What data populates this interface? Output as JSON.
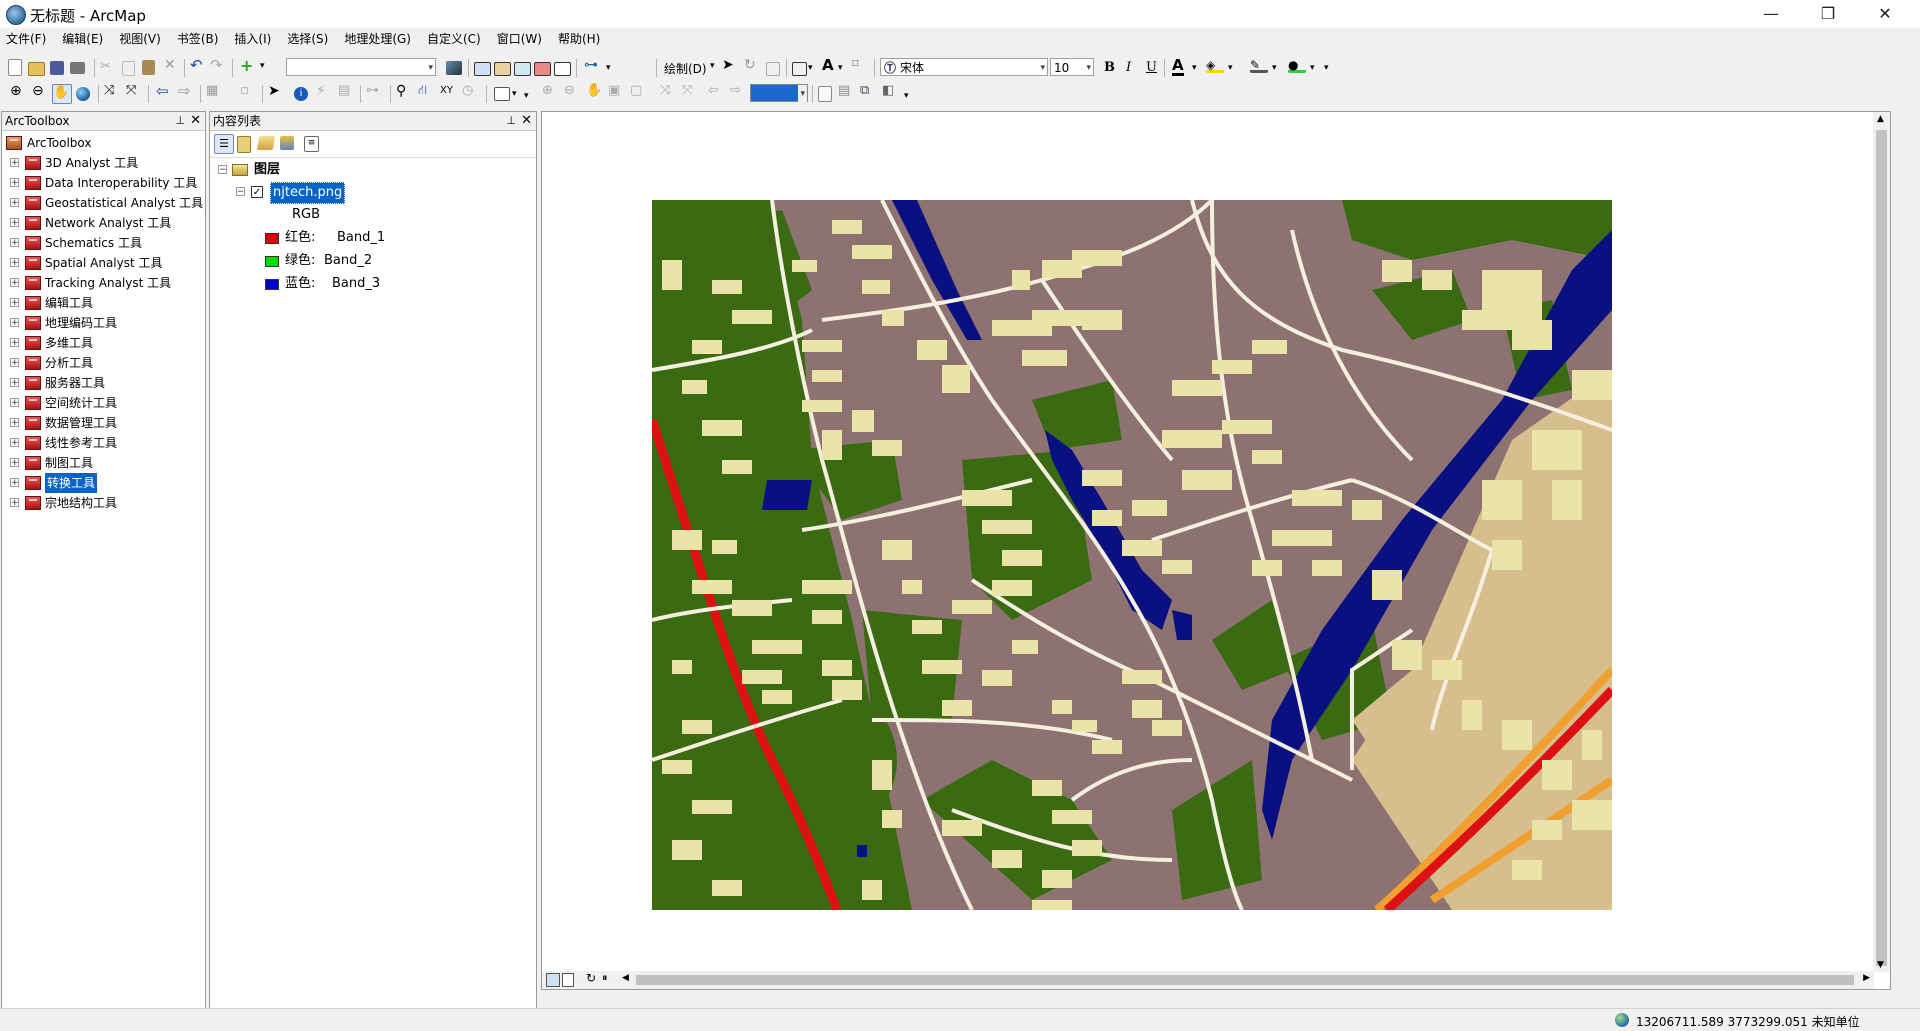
{
  "window": {
    "title": "无标题 - ArcMap",
    "minimize": "—",
    "restore": "❐",
    "close": "✕"
  },
  "menu": [
    "文件(F)",
    "编辑(E)",
    "视图(V)",
    "书签(B)",
    "插入(I)",
    "选择(S)",
    "地理处理(G)",
    "自定义(C)",
    "窗口(W)",
    "帮助(H)"
  ],
  "toolbar": {
    "draw_label": "绘制(D)",
    "font_name": "宋体",
    "font_size": "10",
    "bold": "B",
    "italic": "I",
    "underline": "U",
    "font_color_glyph": "A"
  },
  "arctoolbox": {
    "title": "ArcToolbox",
    "pin": "⊥",
    "close": "✕",
    "root": "ArcToolbox",
    "items": [
      {
        "label": "3D Analyst 工具"
      },
      {
        "label": "Data Interoperability 工具"
      },
      {
        "label": "Geostatistical Analyst 工具"
      },
      {
        "label": "Network Analyst 工具"
      },
      {
        "label": "Schematics 工具"
      },
      {
        "label": "Spatial Analyst 工具"
      },
      {
        "label": "Tracking Analyst 工具"
      },
      {
        "label": "编辑工具"
      },
      {
        "label": "地理编码工具"
      },
      {
        "label": "多维工具"
      },
      {
        "label": "分析工具"
      },
      {
        "label": "服务器工具"
      },
      {
        "label": "空间统计工具"
      },
      {
        "label": "数据管理工具"
      },
      {
        "label": "线性参考工具"
      },
      {
        "label": "制图工具"
      },
      {
        "label": "转换工具",
        "selected": true
      },
      {
        "label": "宗地结构工具"
      }
    ]
  },
  "toc": {
    "title": "内容列表",
    "pin": "⊥",
    "close": "✕",
    "layers_label": "图层",
    "layer_name": "njtech.png",
    "layer_checked": true,
    "rgb_label": "RGB",
    "bands": [
      {
        "color_name": "红色:",
        "band": "Band_1",
        "color": "#e00000"
      },
      {
        "color_name": "绿色:",
        "band": "Band_2",
        "color": "#00dd00"
      },
      {
        "color_name": "蓝色:",
        "band": "Band_3",
        "color": "#0000cc"
      }
    ]
  },
  "map": {
    "colors": {
      "ground": "#8e7272",
      "green": "#3a6b12",
      "building": "#ebe4a8",
      "water": "#0a1080",
      "road": "#f5efdf",
      "highway": "#dd1111",
      "highway2": "#f0a030",
      "sand": "#d6bf8c"
    }
  },
  "status": {
    "coordinates": "13206711.589  3773299.051 未知单位"
  }
}
